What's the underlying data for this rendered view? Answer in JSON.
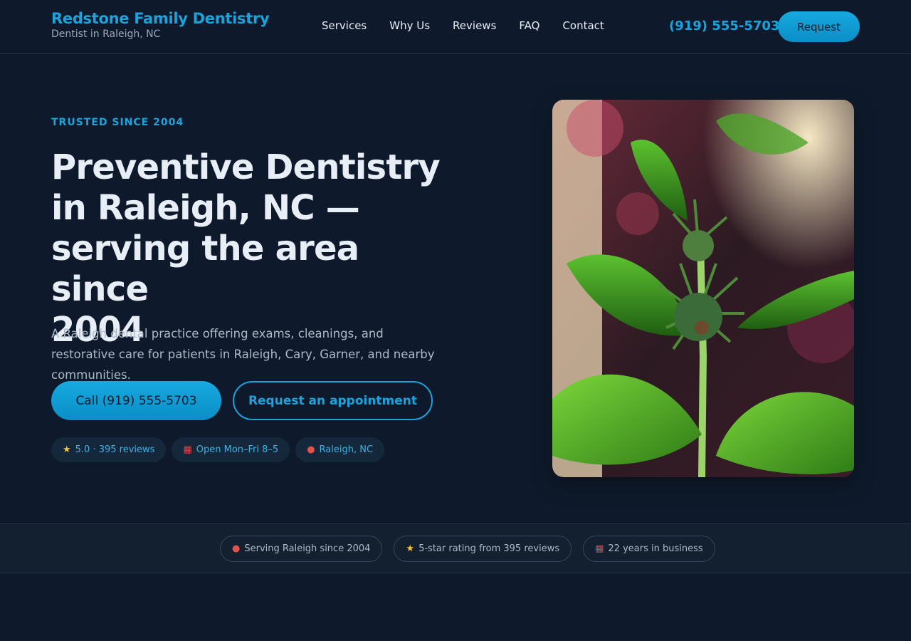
{
  "brand": {
    "name": "Redstone Family Dentistry",
    "tagline": "Dentist in Raleigh, NC"
  },
  "nav": {
    "items": [
      {
        "label": "Services"
      },
      {
        "label": "Why Us"
      },
      {
        "label": "Reviews"
      },
      {
        "label": "FAQ"
      },
      {
        "label": "Contact"
      }
    ]
  },
  "header": {
    "phone": "(919) 555-5703",
    "cta_label": "Request"
  },
  "hero": {
    "eyebrow": "TRUSTED SINCE 2004",
    "title_line1": "Preventive Dentistry",
    "title_line2": "in Raleigh, NC —",
    "title_line3": "serving the area since",
    "title_line4": "2004",
    "description": "A Raleigh dental practice offering exams, cleanings, and restorative care for patients in Raleigh, Cary, Garner, and nearby communities.",
    "call_button": "Call (919) 555-5703",
    "request_button": "Request an appointment",
    "chips": [
      {
        "icon": "star-icon",
        "text": "5.0 · 395 reviews"
      },
      {
        "icon": "calendar-icon",
        "text": "Open Mon–Fri 8–5"
      },
      {
        "icon": "pin-icon",
        "text": "Raleigh, NC"
      }
    ]
  },
  "trust_bar": {
    "items": [
      {
        "icon": "pin-icon",
        "text": "Serving Raleigh since 2004"
      },
      {
        "icon": "star-icon",
        "text": "5-star rating from 395 reviews"
      },
      {
        "icon": "calendar-icon",
        "text": "22 years in business"
      }
    ]
  },
  "colors": {
    "background": "#0e1a2b",
    "accent": "#1ba3dd",
    "text": "#e8eef6",
    "muted": "#aeb9c8"
  }
}
